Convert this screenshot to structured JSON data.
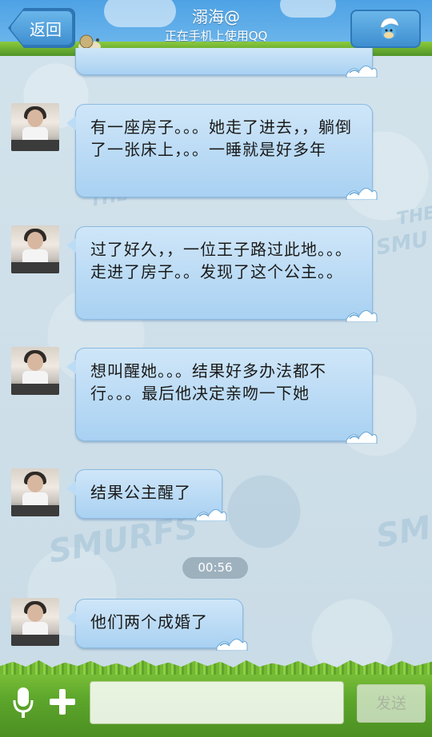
{
  "header": {
    "back_label": "返回",
    "contact_name": "溺海@",
    "status": "正在手机上使用QQ"
  },
  "messages": [
    {
      "text": "有一座房子。。。她走了进去，，躺倒了一张床上，。。一睡就是好多年"
    },
    {
      "text": "过了好久，，一位王子路过此地。。。走进了房子。。发现了这个公主。。"
    },
    {
      "text": "想叫醒她。。。结果好多办法都不行。。。最后他决定亲吻一下她"
    },
    {
      "text": "结果公主醒了"
    },
    {
      "text": "他们两个成婚了"
    }
  ],
  "timestamp": "00:56",
  "input": {
    "placeholder": "",
    "send_label": "发送"
  },
  "icons": {
    "mic": "microphone-icon",
    "plus": "plus-icon",
    "avatar": "smurf-avatar-icon"
  },
  "colors": {
    "bubble": "#b9dcf5",
    "header": "#4ea2e4",
    "grass": "#6db032"
  }
}
